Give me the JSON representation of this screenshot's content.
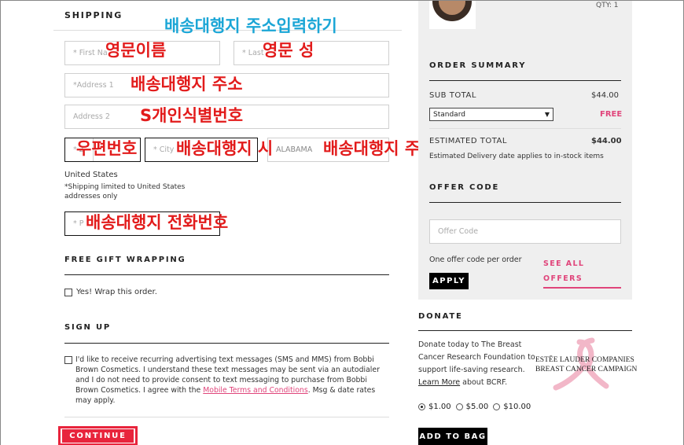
{
  "shipping": {
    "title": "SHIPPING",
    "fields": {
      "first_name_placeholder": "* First Na",
      "last_name_placeholder": "* Last",
      "address1_placeholder": "*Address 1",
      "address2_placeholder": "Address 2",
      "zip_placeholder": "* Z",
      "city_placeholder": "* City",
      "state_value": "ALABAMA",
      "phone_placeholder": "* P"
    },
    "country": "United States",
    "shipping_note": "*Shipping limited to United States addresses only"
  },
  "annotations": {
    "header": "배송대행지 주소입력하기",
    "first_name": "영문이름",
    "last_name": "영문 성",
    "address1": "배송대행지 주소",
    "address2": "S개인식별번호",
    "zip": "우편번호",
    "city": "배송대행지 시",
    "state": "배송대행지 주",
    "phone": "배송대행지 전화번호"
  },
  "gift_wrap": {
    "title": "FREE GIFT WRAPPING",
    "checkbox_label": "Yes! Wrap this order."
  },
  "signup": {
    "title": "SIGN UP",
    "consent_text_part1": "I'd like to receive recurring advertising text messages (SMS and MMS) from Bobbi Brown Cosmetics. I understand these text messages may be sent via an autodialer and I do not need to provide consent to text messaging to purchase from Bobbi Brown Cosmetics. I agree with the ",
    "consent_link": "Mobile Terms and Conditions",
    "consent_text_part2": ". Msg & date rates may apply."
  },
  "continue_label": "CONTINUE",
  "cart": {
    "qty": "QTY: 1"
  },
  "order_summary": {
    "title": "ORDER SUMMARY",
    "subtotal_label": "SUB TOTAL",
    "subtotal_value": "$44.00",
    "shipping_option": "Standard",
    "shipping_cost": "FREE",
    "estimated_label": "ESTIMATED TOTAL",
    "estimated_value": "$44.00",
    "delivery_note": "Estimated Delivery date applies to in-stock items"
  },
  "offer": {
    "title": "OFFER CODE",
    "placeholder": "Offer Code",
    "note": "One offer code per order",
    "see_all": "SEE ALL OFFERS",
    "apply_label": "APPLY"
  },
  "donate": {
    "title": "DONATE",
    "text_part1": "Donate today to The Breast Cancer Research Foundation to support life-saving research. ",
    "learn_more": "Learn More",
    "text_part2": " about BCRF.",
    "logo_line1": "ESTĒE LAUDER COMPANIES",
    "logo_line2": "BREAST CANCER CAMPAIGN",
    "options": [
      "$1.00",
      "$5.00",
      "$10.00"
    ],
    "selected": 0,
    "add_to_bag_label": "ADD TO BAG"
  },
  "colors": {
    "annotation_red": "#e21b1b",
    "annotation_cyan": "#1ba6d6",
    "accent_pink": "#e0457b",
    "continue_red": "#e8243c"
  }
}
